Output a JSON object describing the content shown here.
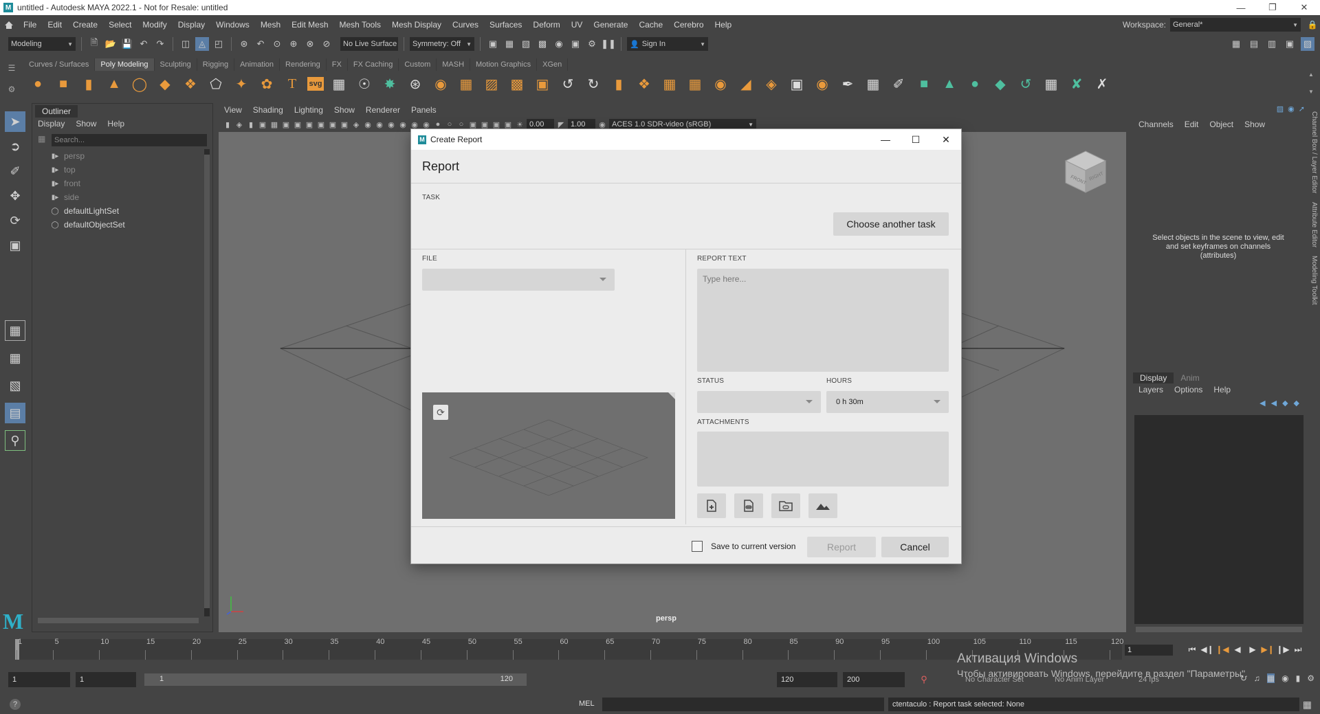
{
  "window": {
    "title": "untitled - Autodesk MAYA 2022.1 - Not for Resale: untitled",
    "app_icon": "maya-icon"
  },
  "menubar": {
    "items": [
      "File",
      "Edit",
      "Create",
      "Select",
      "Modify",
      "Display",
      "Windows",
      "Mesh",
      "Edit Mesh",
      "Mesh Tools",
      "Mesh Display",
      "Curves",
      "Surfaces",
      "Deform",
      "UV",
      "Generate",
      "Cache",
      "Cerebro",
      "Help"
    ],
    "workspace_label": "Workspace:",
    "workspace_value": "General*"
  },
  "statusline": {
    "mode": "Modeling",
    "live_surface": "No Live Surface",
    "symmetry": "Symmetry: Off",
    "sign_in": "Sign In"
  },
  "shelf": {
    "tabs": [
      "Curves / Surfaces",
      "Poly Modeling",
      "Sculpting",
      "Rigging",
      "Animation",
      "Rendering",
      "FX",
      "FX Caching",
      "Custom",
      "MASH",
      "Motion Graphics",
      "XGen"
    ],
    "active_tab": "Poly Modeling"
  },
  "outliner": {
    "tab": "Outliner",
    "menu": [
      "Display",
      "Show",
      "Help"
    ],
    "search_placeholder": "Search...",
    "items": [
      {
        "label": "persp",
        "icon": "camera-icon",
        "dim": true
      },
      {
        "label": "top",
        "icon": "camera-icon",
        "dim": true
      },
      {
        "label": "front",
        "icon": "camera-icon",
        "dim": true
      },
      {
        "label": "side",
        "icon": "camera-icon",
        "dim": true
      },
      {
        "label": "defaultLightSet",
        "icon": "set-icon",
        "dim": false
      },
      {
        "label": "defaultObjectSet",
        "icon": "set-icon",
        "dim": false
      }
    ]
  },
  "viewport": {
    "menu": [
      "View",
      "Shading",
      "Lighting",
      "Show",
      "Renderer",
      "Panels"
    ],
    "field_a": "0.00",
    "field_b": "1.00",
    "color_management": "ACES 1.0 SDR-video (sRGB)",
    "camera_label": "persp",
    "viewcube_front": "FRONT",
    "viewcube_right": "RIGHT"
  },
  "channelbox": {
    "menu": [
      "Channels",
      "Edit",
      "Object",
      "Show"
    ],
    "message": "Select objects in the scene to view, edit and set keyframes on channels (attributes)",
    "tabs": [
      "Display",
      "Anim"
    ],
    "sub_menu": [
      "Layers",
      "Options",
      "Help"
    ],
    "side_tabs": [
      "Channel Box / Layer Editor",
      "Attribute Editor",
      "Modeling Toolkit"
    ]
  },
  "timeslider": {
    "ticks": [
      "1",
      "5",
      "10",
      "15",
      "20",
      "25",
      "30",
      "35",
      "40",
      "45",
      "50",
      "55",
      "60",
      "65",
      "70",
      "75",
      "80",
      "85",
      "90",
      "95",
      "100",
      "105",
      "110",
      "115",
      "120"
    ],
    "current_frame": "1"
  },
  "rangeslider": {
    "start": "1",
    "playback_start": "1",
    "range_start": "1",
    "range_end": "120",
    "playback_end": "120",
    "end": "200",
    "character_set": "No Character Set",
    "anim_layer": "No Anim Layer",
    "fps": "24 fps"
  },
  "cmdline": {
    "lang": "MEL",
    "result": "ctentaculo : Report task selected: None"
  },
  "watermark": {
    "title": "Активация Windows",
    "subtitle": "Чтобы активировать Windows, перейдите в раздел \"Параметры\"."
  },
  "dialog": {
    "title": "Create Report",
    "heading": "Report",
    "task_label": "TASK",
    "choose_task": "Choose another task",
    "file_label": "FILE",
    "file_value": "",
    "report_text_label": "REPORT TEXT",
    "report_text_placeholder": "Type here...",
    "status_label": "STATUS",
    "status_value": "",
    "hours_label": "HOURS",
    "hours_value": "0 h 30m",
    "attachments_label": "ATTACHMENTS",
    "save_version_label": "Save to current version",
    "save_version_checked": false,
    "report_button": "Report",
    "cancel_button": "Cancel"
  }
}
